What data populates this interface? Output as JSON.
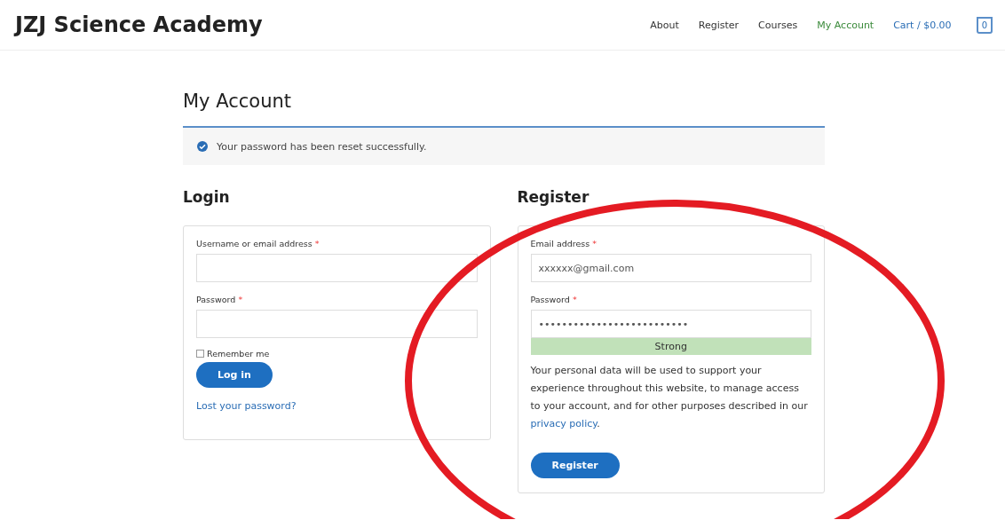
{
  "site_title": "JZJ Science Academy",
  "nav": [
    {
      "label": "About",
      "selected": false
    },
    {
      "label": "Register",
      "selected": false
    },
    {
      "label": "Courses",
      "selected": false
    },
    {
      "label": "My Account",
      "selected": true
    }
  ],
  "cart": {
    "label": "Cart / $0.00",
    "count": "0"
  },
  "page_title": "My Account",
  "required_mark": "*",
  "notice": "Your password has been reset successfully.",
  "login": {
    "title": "Login",
    "fields": [
      {
        "label": "Username or email address",
        "required": true
      },
      {
        "label": "Password",
        "required": true
      }
    ],
    "remember": {
      "label": "Remember me",
      "checked": false
    },
    "button": "Log in",
    "lost_link": "Lost your password?"
  },
  "register": {
    "title": "Register",
    "fields": [
      {
        "label": "Email address",
        "required": true,
        "value": "xxxxxx@gmail.com"
      },
      {
        "label": "Password",
        "required": true,
        "value": "••••••••••••••••••••••••••"
      }
    ],
    "strength": "Strong",
    "privacy_text": "Your personal data will be used to support your experience throughout this website, to manage access to your account, and for other purposes described in our ",
    "privacy_link": "privacy policy",
    "privacy_end": ".",
    "button": "Register"
  }
}
